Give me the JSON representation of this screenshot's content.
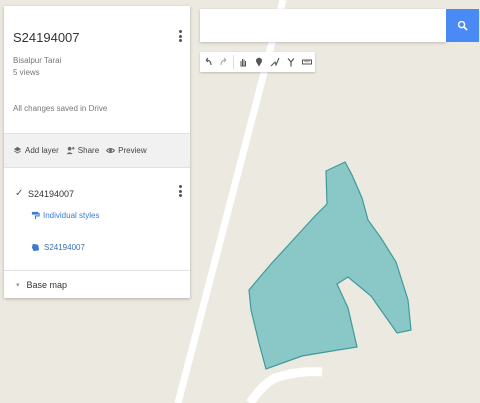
{
  "map_doc": {
    "title": "S24194007",
    "subtitle": "Bisalpur Tarai",
    "views": "5 views",
    "save_status": "All changes saved in Drive"
  },
  "actions": {
    "add_layer": "Add layer",
    "share": "Share",
    "preview": "Preview"
  },
  "layer": {
    "name": "S24194007",
    "styles_label": "Individual styles",
    "feature_name": "S24194007"
  },
  "basemap": {
    "label": "Base map"
  },
  "search": {
    "value": "",
    "icon": "search-icon"
  },
  "toolbar": {
    "icons": [
      "undo-icon",
      "redo-icon",
      "hand-icon",
      "marker-icon",
      "draw-line-icon",
      "route-icon",
      "ruler-icon"
    ]
  },
  "colors": {
    "accent": "#4a8af4",
    "polygon_fill": "#7fc4c4",
    "polygon_stroke": "#3f9a9a",
    "map_background": "#ece9e0"
  }
}
